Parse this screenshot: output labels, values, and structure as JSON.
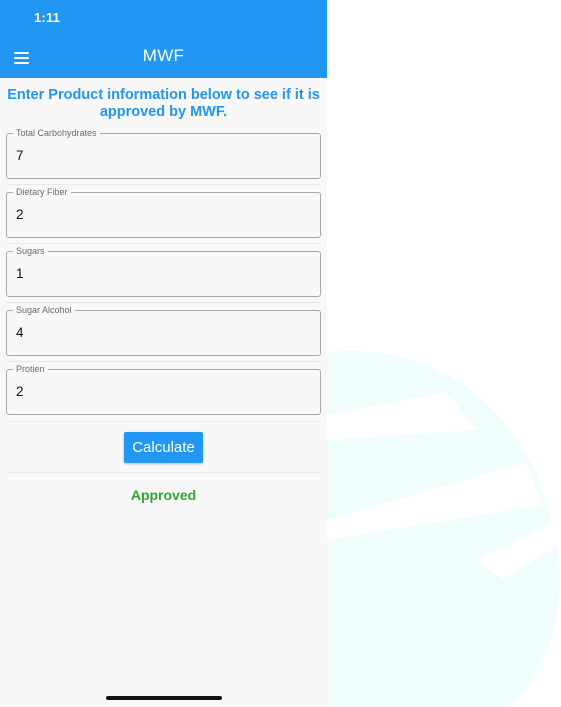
{
  "status_bar": {
    "time": "1:11"
  },
  "app_bar": {
    "title": "MWF",
    "menu_icon": "hamburger-menu-icon"
  },
  "intro_text": "Enter Product information below to see if it is approved by MWF.",
  "fields": [
    {
      "label": "Total Carbohydrates",
      "value": "7"
    },
    {
      "label": "Dietary Fiber",
      "value": "2"
    },
    {
      "label": "Sugars",
      "value": "1"
    },
    {
      "label": "Sugar Alcohol",
      "value": "4"
    },
    {
      "label": "Protien",
      "value": "2"
    }
  ],
  "calculate_button": {
    "label": "Calculate"
  },
  "result": {
    "text": "Approved",
    "color": "#33a533"
  },
  "colors": {
    "primary": "#2196f3",
    "background": "#f8f8f8",
    "backdrop": "#eefdfd"
  }
}
